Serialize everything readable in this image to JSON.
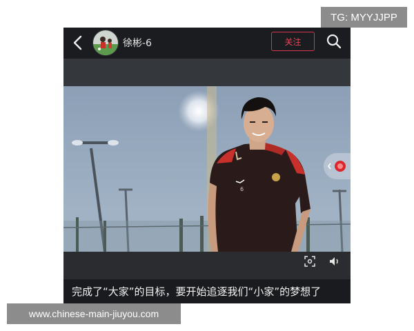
{
  "watermark_top": "TG: MYYJJPP",
  "watermark_bottom": "www.chinese-main-jiuyou.com",
  "header": {
    "back_icon": "back-arrow-icon",
    "avatar_icon": "avatar",
    "username": "徐彬-6",
    "follow_label": "关注",
    "search_icon": "search-icon"
  },
  "video": {
    "scene": "player-portrait",
    "jersey_number": "6",
    "controls": {
      "screenshot_icon": "screen-capture-icon",
      "volume_icon": "volume-icon"
    },
    "side_tab_icon": "red-live-badge-icon"
  },
  "caption": "完成了“大家”的目标，要开始追逐我们“小家”的梦想了",
  "colors": {
    "follow_accent": "#e8475a",
    "background": "#1a1b1e"
  }
}
